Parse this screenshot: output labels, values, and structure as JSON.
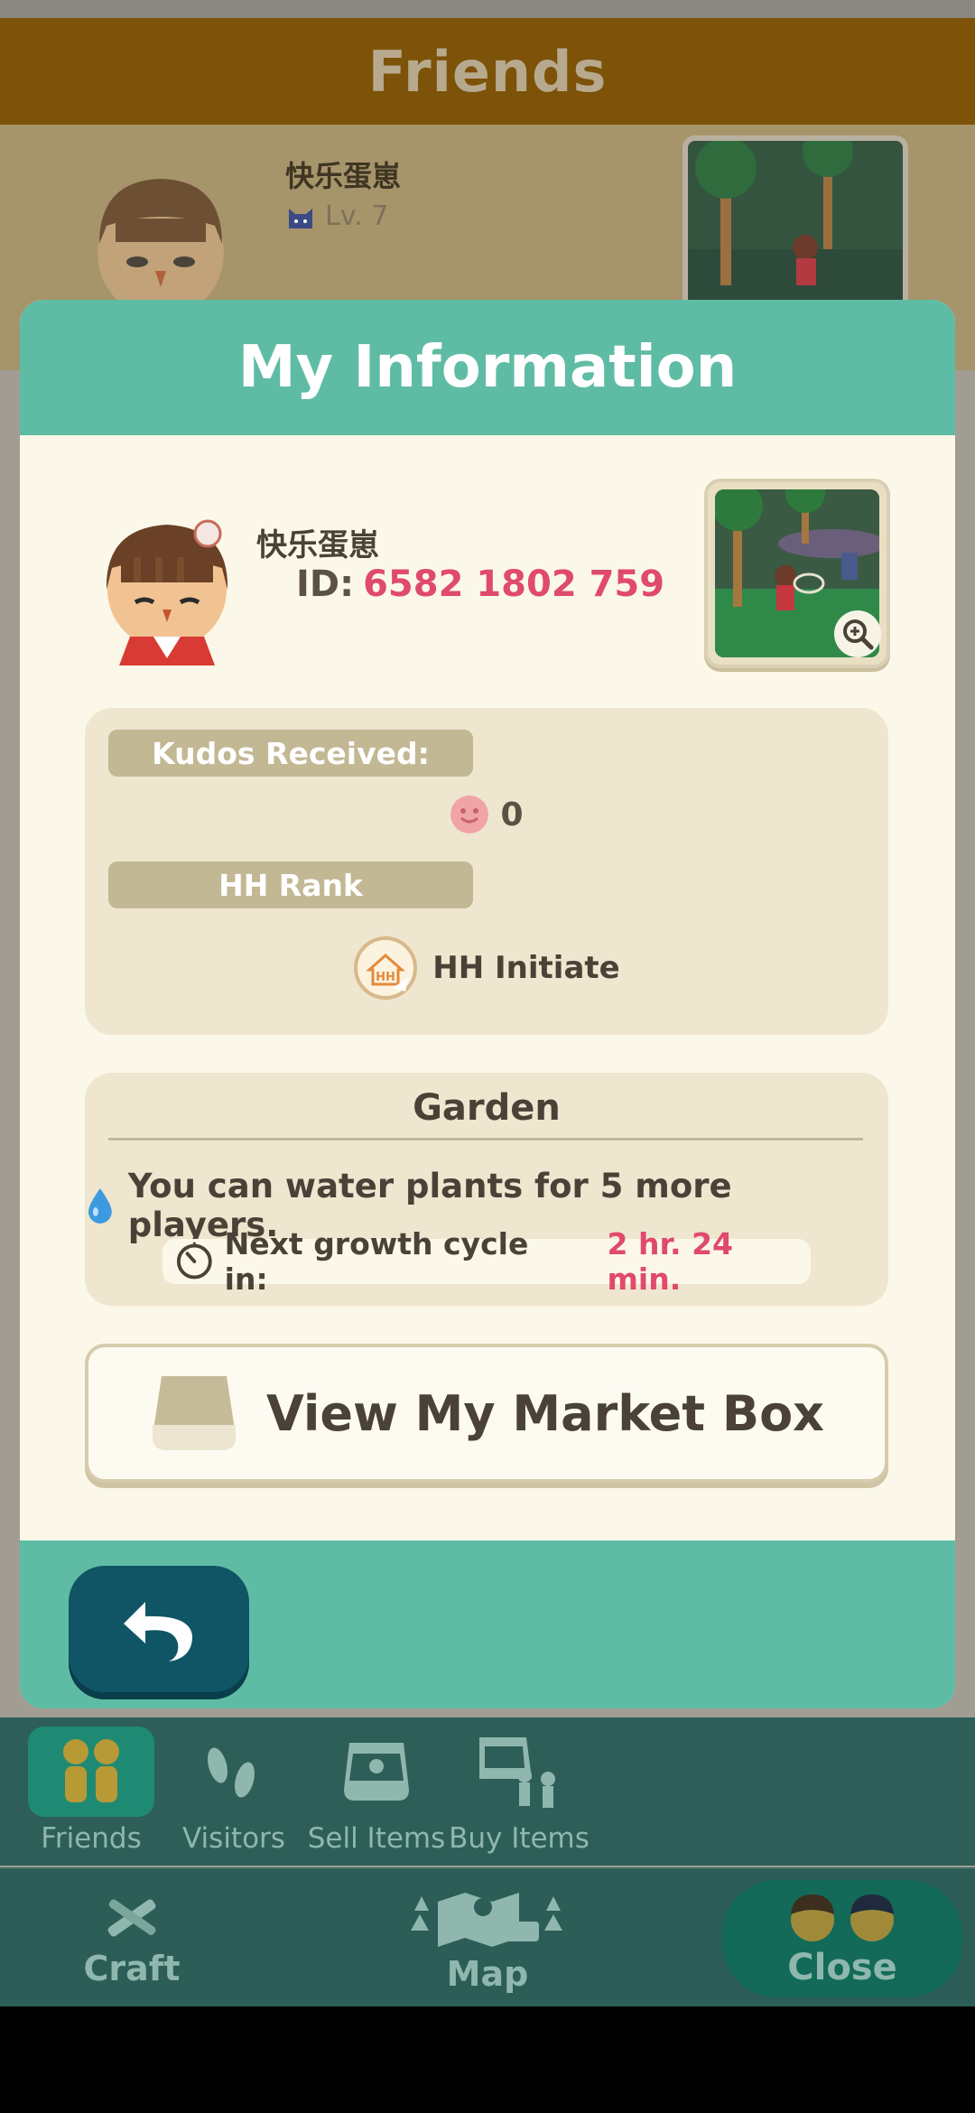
{
  "background": {
    "header_title": "Friends",
    "friend_name": "快乐蛋崽",
    "friend_level": "Lv. 7"
  },
  "modal": {
    "title": "My Information",
    "profile": {
      "name": "快乐蛋崽",
      "id_label": "ID:",
      "id_value": "6582 1802 759"
    },
    "kudos": {
      "label": "Kudos Received:",
      "value": "0"
    },
    "rank": {
      "label": "HH Rank",
      "value": "HH Initiate"
    },
    "garden": {
      "title": "Garden",
      "water_text": "You can water plants for 5 more players.",
      "growth_label": "Next growth cycle in:",
      "growth_time": "2 hr. 24 min."
    },
    "market_button": "View My Market Box"
  },
  "sub_tabs": [
    {
      "label": "Friends",
      "icon": "friends-icon",
      "active": true
    },
    {
      "label": "Visitors",
      "icon": "footprints-icon",
      "active": false
    },
    {
      "label": "Sell Items",
      "icon": "market-box-icon",
      "active": false
    },
    {
      "label": "Buy Items",
      "icon": "buy-items-icon",
      "active": false
    }
  ],
  "main_tabs": {
    "craft": "Craft",
    "map": "Map",
    "close": "Close"
  },
  "colors": {
    "accent_teal": "#5fbca4",
    "id_pink": "#e04a6c",
    "panel_beige": "#efe6cf",
    "dark_teal_button": "#0f5565"
  }
}
